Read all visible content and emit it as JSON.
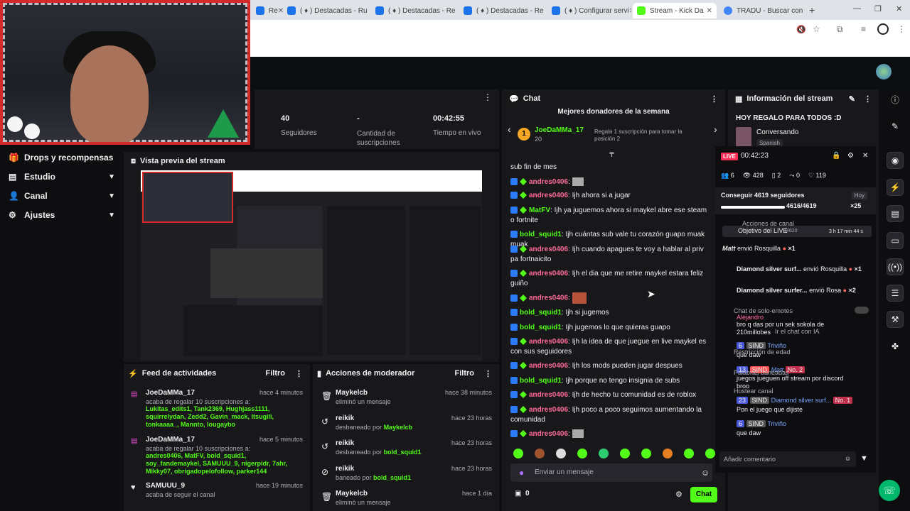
{
  "browser": {
    "tabs": [
      {
        "title": "Re"
      },
      {
        "title": "( ♦ ) Destacadas - Ru"
      },
      {
        "title": "( ♦ ) Destacadas - Re"
      },
      {
        "title": "( ♦ ) Destacadas - Re"
      },
      {
        "title": "( ♦ ) Configurar servi"
      },
      {
        "title": "Stream - Kick Da"
      },
      {
        "title": "TRADU - Buscar con"
      }
    ],
    "new_tab": "+"
  },
  "stats": [
    {
      "value": "40",
      "label": "Seguidores"
    },
    {
      "value": "-",
      "label": "Cantidad de suscripciones"
    },
    {
      "value": "00:42:55",
      "label": "Tiempo en vivo"
    }
  ],
  "nav": [
    {
      "label": "Drops y recompensas",
      "icon": "gift-icon"
    },
    {
      "label": "Estudio",
      "icon": "studio-icon"
    },
    {
      "label": "Canal",
      "icon": "user-icon"
    },
    {
      "label": "Ajustes",
      "icon": "gear-icon"
    }
  ],
  "preview": {
    "title": "Vista previa del stream"
  },
  "feed": {
    "title": "Feed de actividades",
    "filter": "Filtro",
    "items": [
      {
        "user": "JoeDaMMa_17",
        "time": "hace 4 minutos",
        "text": "acaba de regalar 10 suscripciones a:",
        "names": "Lukitas_edits1, Tank2369, Hughjass1111, squirrelydan, Zedd2, Gavin_mack, Itsugili, tonkaaaa_, Mannto, lougaybo"
      },
      {
        "user": "JoeDaMMa_17",
        "time": "hace 5 minutos",
        "text": "acaba de regalar 10 suscripciones a:",
        "names": "andres0406, MatFV, bold_squid1, soy_fandemaykel, SAMUUU_9, nigerpidr, 7ahr, Mikky07, obrigadopelofollow, parker144"
      },
      {
        "user": "SAMUUU_9",
        "time": "hace 19 minutos",
        "text": "acaba de seguir el canal",
        "names": ""
      }
    ]
  },
  "mod": {
    "title": "Acciones de moderador",
    "filter": "Filtro",
    "items": [
      {
        "user": "Maykelcb",
        "time": "hace 38 minutos",
        "action": "eliminó un mensaje",
        "by": ""
      },
      {
        "user": "reikik",
        "time": "hace 23 horas",
        "action": "desbaneado por ",
        "by": "Maykelcb"
      },
      {
        "user": "reikik",
        "time": "hace 23 horas",
        "action": "desbaneado por ",
        "by": "bold_squid1"
      },
      {
        "user": "reikik",
        "time": "hace 23 horas",
        "action": "baneado por ",
        "by": "bold_squid1"
      },
      {
        "user": "Maykelcb",
        "time": "hace 1 día",
        "action": "eliminó un mensaje",
        "by": ""
      }
    ]
  },
  "chat": {
    "title": "Chat",
    "donors_title": "Mejores donadores de la semana",
    "donor": {
      "name": "JoeDaMMa_17",
      "count": "20",
      "desc": "Regala 1 suscripción para tomar la posición 2"
    },
    "messages": [
      {
        "user": "",
        "text": "sub fin de mes"
      },
      {
        "user": "andres0406",
        "text": ""
      },
      {
        "user": "andres0406",
        "text": "Ijh ahora si a jugar"
      },
      {
        "user": "MatFV",
        "text": "Ijh ya juguemos ahora si maykel abre ese steam o fortnite"
      },
      {
        "user": "bold_squid1",
        "text": "Ijh cuántas sub vale tu corazón guapo muak muak"
      },
      {
        "user": "andres0406",
        "text": "Ijh cuando apagues te voy a hablar al priv pa fortnaicito"
      },
      {
        "user": "andres0406",
        "text": "Ijh el dia que me retire maykel estara feliz guiño"
      },
      {
        "user": "andres0406",
        "text": ""
      },
      {
        "user": "bold_squid1",
        "text": "Ijh si jugemos"
      },
      {
        "user": "bold_squid1",
        "text": "Ijh jugemos lo que quieras guapo"
      },
      {
        "user": "andres0406",
        "text": "Ijh la idea de que juegue en live maykel es con sus seguidores"
      },
      {
        "user": "andres0406",
        "text": "Ijh los mods pueden jugar despues"
      },
      {
        "user": "bold_squid1",
        "text": "Ijh porque no tengo insignia de subs"
      },
      {
        "user": "andres0406",
        "text": "Ijh de hecho tu comunidad es de roblox"
      },
      {
        "user": "andres0406",
        "text": "Ijh poco a poco seguimos aumentando la comunidad"
      },
      {
        "user": "andres0406",
        "text": ""
      }
    ],
    "input_placeholder": "Enviar un mensaje",
    "points": "0",
    "send": "Chat"
  },
  "info": {
    "title": "Información del stream",
    "stream_title": "HOY REGALO PARA TODOS :D",
    "category": "Conversando",
    "language": "Spanish"
  },
  "overlay": {
    "live": "LIVE",
    "uptime": "00:42:23",
    "viewers": "6",
    "views": "428",
    "stat3": "2",
    "stat4": "0",
    "likes": "119",
    "goal": "Conseguir 4619 seguidores",
    "goal_time": "Hoy",
    "goal_progress": "4616/4619",
    "goal_fraction": 0.9994,
    "goal_mult": "×25",
    "objective": "Objetivo del LIVE",
    "objective_count": "0/620",
    "objective_time": "3 h 17 min 44 s",
    "canal_actions": "Acciones de canal",
    "gifts": [
      {
        "user": "Matt",
        "text": "envió Rosquilla",
        "mult": "×1"
      },
      {
        "user": "Diamond silver surf...",
        "text": "envió Rosquilla",
        "mult": "×1"
      },
      {
        "user": "Diamond silver surfer...",
        "text": "envió Rosa",
        "mult": "×2"
      }
    ],
    "menu1": "Chat de solo-emotes",
    "chat": [
      {
        "user": "Alejandro",
        "text": "bro q das por un sek sokola de 210millobes"
      },
      {
        "user": "",
        "text": "Ir el chat con IA"
      },
      {
        "user": "Triviño",
        "text": "que daw"
      },
      {
        "user": "Matt",
        "text": "juegos jueguen off stream por discord broo"
      },
      {
        "user": "Diamond silver surf...",
        "text": "Pon el juego que dijiste"
      },
      {
        "user": "Triviño",
        "text": "que daw"
      }
    ],
    "menu2": "Restricción de edad",
    "menu3": "Palabras baneadas",
    "menu4": "Hostear canal",
    "badge_lvls": [
      "6",
      "13",
      "23",
      "6"
    ],
    "no2": "No. 2",
    "no1": "No. 1",
    "sind": "SIND",
    "comment_placeholder": "Añadir comentario"
  }
}
